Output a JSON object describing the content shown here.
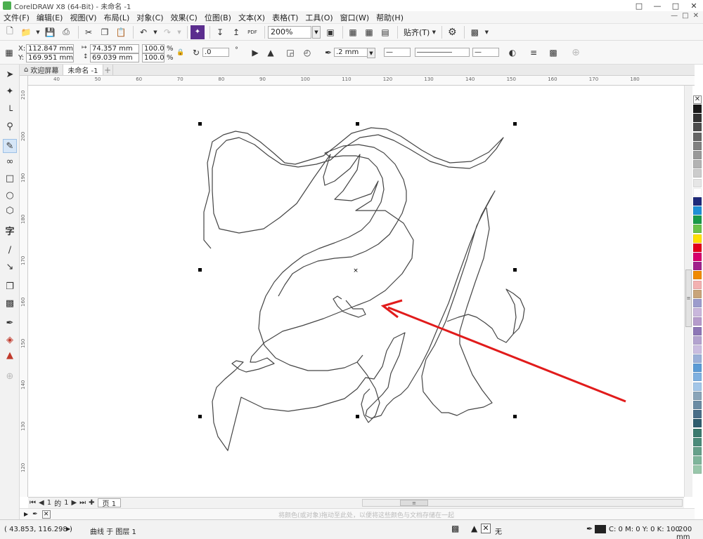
{
  "window": {
    "title": "CorelDRAW X8 (64-Bit) - 未命名 -1",
    "controls": [
      "□",
      "—",
      "□",
      "✕"
    ]
  },
  "menu": {
    "items": [
      "文件(F)",
      "编辑(E)",
      "视图(V)",
      "布局(L)",
      "对象(C)",
      "效果(C)",
      "位图(B)",
      "文本(X)",
      "表格(T)",
      "工具(O)",
      "窗口(W)",
      "帮助(H)"
    ],
    "right_controls": [
      "—",
      "□",
      "✕"
    ]
  },
  "toolbar": {
    "zoom": "200%",
    "snap_label": "贴齐(T)",
    "pdf_label": "PDF"
  },
  "properties": {
    "x_label": "X:",
    "x_value": "112.847 mm",
    "y_label": "Y:",
    "y_value": "169.951 mm",
    "width_value": "74.357 mm",
    "height_value": "69.039 mm",
    "scale_w": "100.0",
    "scale_h": "100.0",
    "percent": "%",
    "rotation": ".0",
    "outline_width": ".2 mm"
  },
  "tabs": {
    "welcome": "欢迎屏幕",
    "document": "未命名 -1",
    "add": "+"
  },
  "ruler": {
    "h_ticks": [
      "40",
      "50",
      "60",
      "70",
      "80",
      "90",
      "100",
      "110",
      "120",
      "130",
      "140",
      "150",
      "160",
      "170",
      "180"
    ],
    "v_ticks": [
      "210",
      "200",
      "190",
      "180",
      "170",
      "160",
      "150",
      "140",
      "130",
      "120"
    ]
  },
  "page_nav": {
    "current": "1",
    "of": "的",
    "total": "1",
    "page_tab": "页 1"
  },
  "doc_palette": {
    "hint": "将颜色(或对象)拖动至此处，以便将这些颜色与文档存储在一起"
  },
  "status": {
    "coords": "( 43.853, 116.298 )",
    "object_info": "曲线 于 图层 1",
    "fill_none": "无",
    "outline_color": "C: 0 M: 0 Y: 0 K: 100",
    "outline_width": ".200 mm"
  },
  "palette_colors": [
    "#1a1a1a",
    "#333333",
    "#4d4d4d",
    "#666666",
    "#808080",
    "#999999",
    "#b3b3b3",
    "#cccccc",
    "#e6e6e6",
    "#ffffff",
    "#1f2a7a",
    "#1e90d6",
    "#199a48",
    "#6cc24a",
    "#ffe000",
    "#e3001b",
    "#d6006d",
    "#a0228c",
    "#f08a00",
    "#f3b1b1",
    "#c8a47a",
    "#9c9ccc",
    "#c9b7dc",
    "#b59bcb",
    "#8d76b6",
    "#b3a3cf",
    "#cabde0",
    "#9bb0d8",
    "#5b9bd5",
    "#7fb0e0",
    "#a3c6e8",
    "#8aa4b8",
    "#6b8ca4",
    "#4a6e88",
    "#2f5d6e",
    "#3b7a6e",
    "#4b8b7a",
    "#66a08a",
    "#7fb59b",
    "#99c7ab"
  ],
  "colors": {
    "arrow": "#e11b1b",
    "outline": "#444444"
  }
}
